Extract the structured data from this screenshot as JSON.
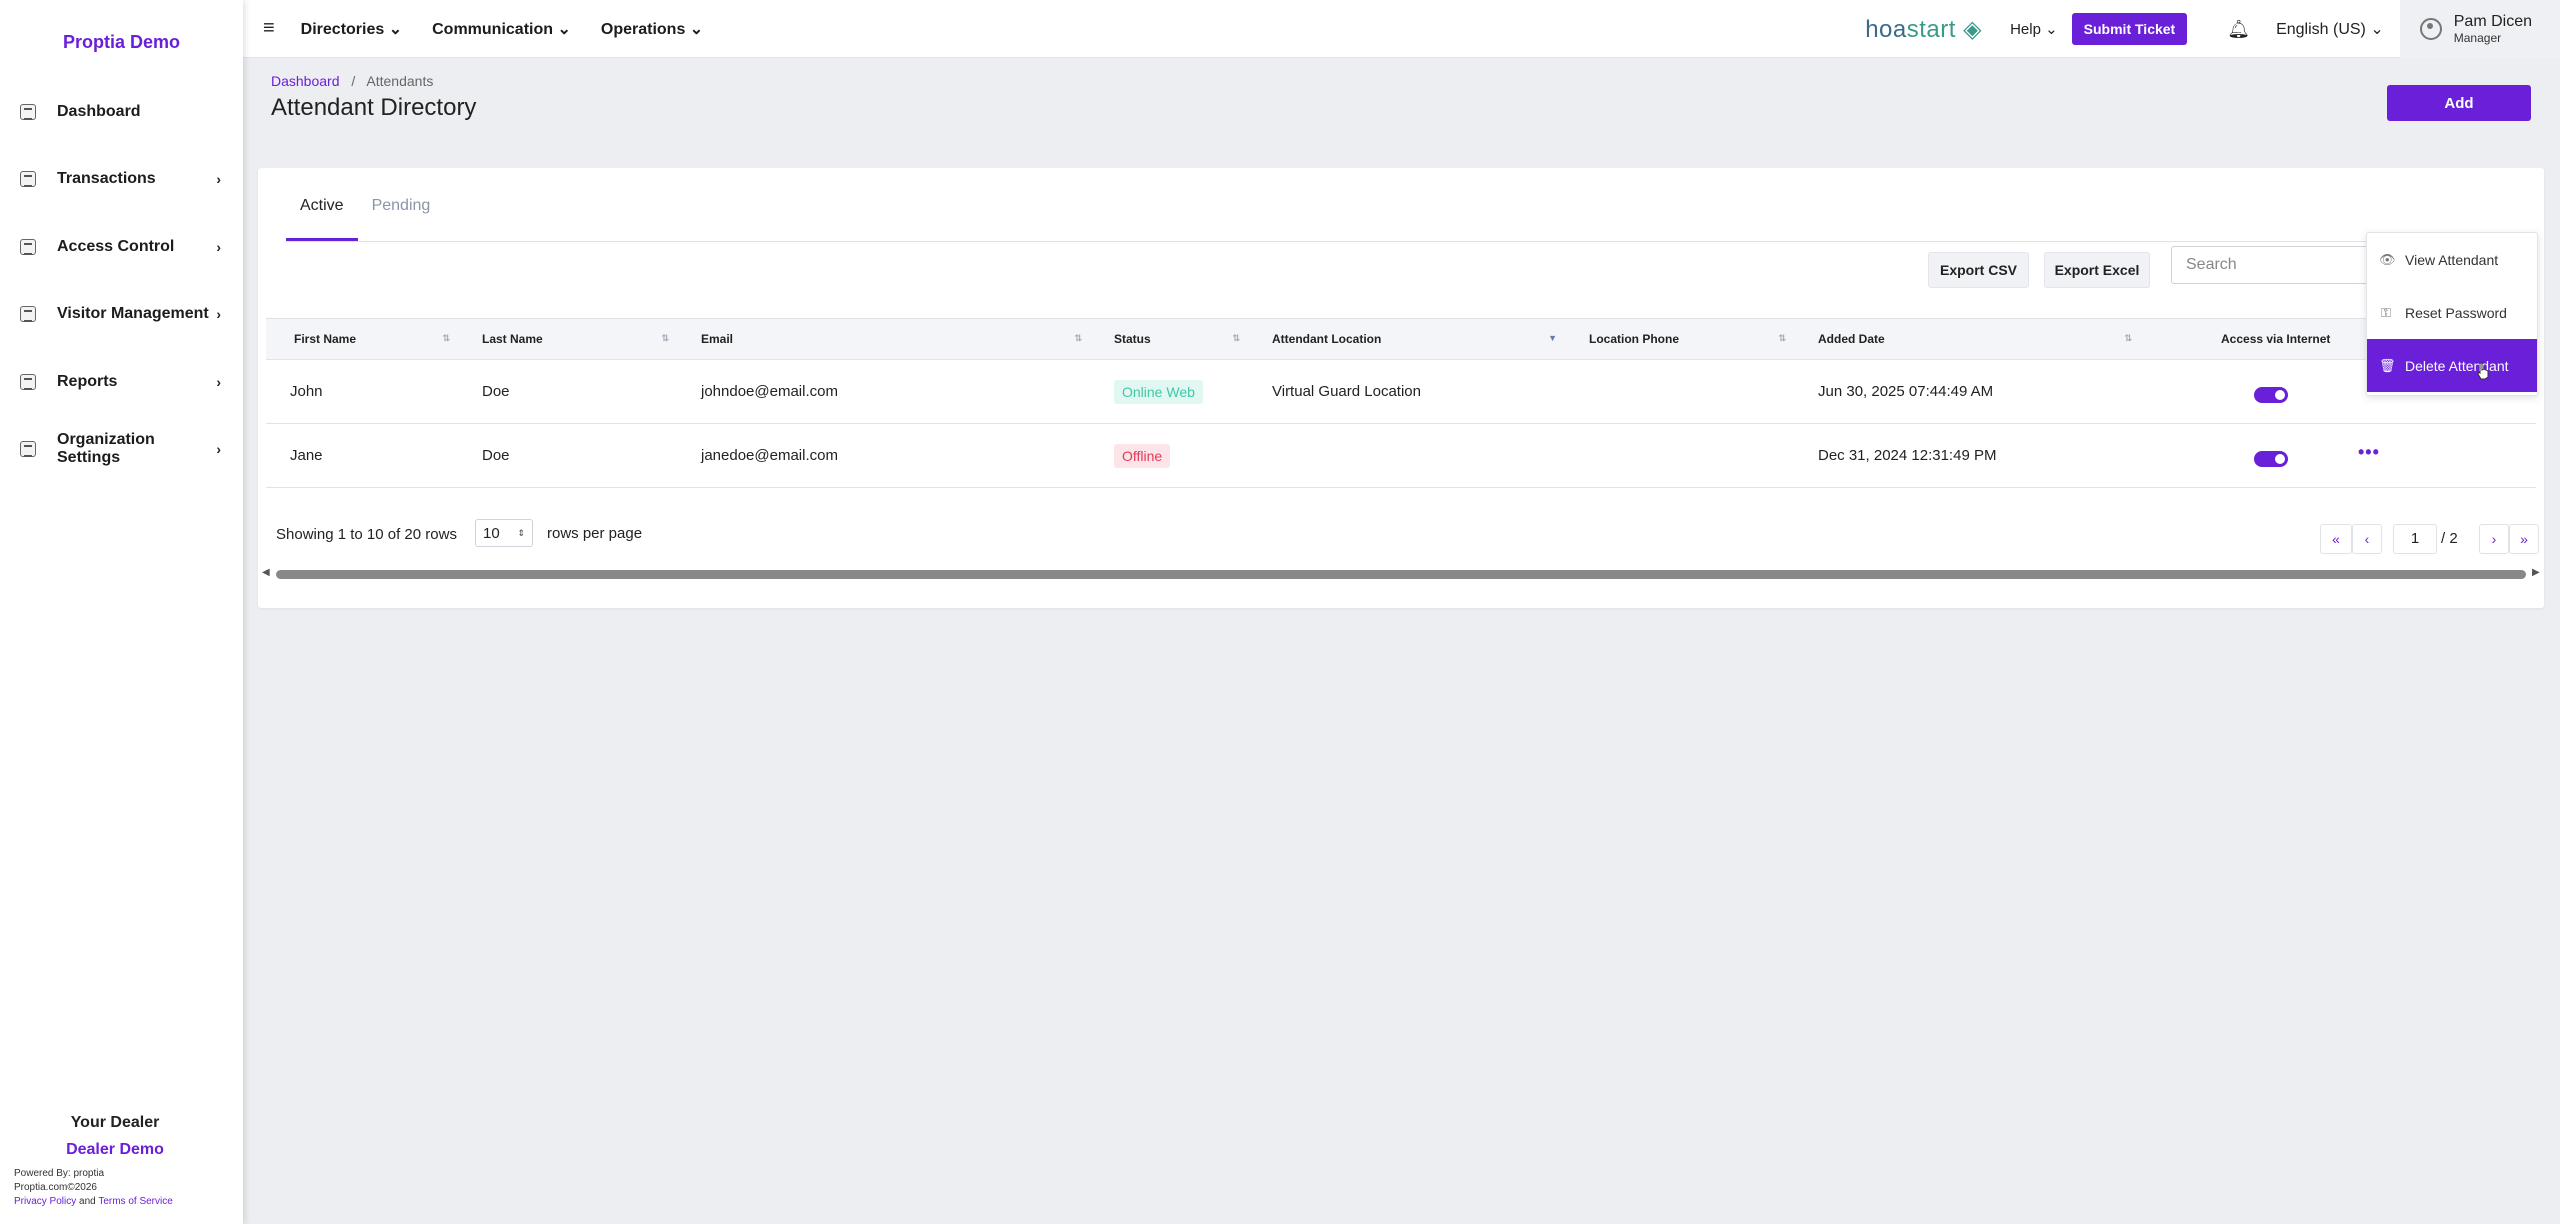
{
  "sidebar": {
    "brand": "Proptia Demo",
    "items": [
      {
        "label": "Dashboard",
        "icon": "dashboard-icon",
        "chevron": ""
      },
      {
        "label": "Transactions",
        "icon": "transactions-icon",
        "chevron": "›"
      },
      {
        "label": "Access Control",
        "icon": "access-control-icon",
        "chevron": "›"
      },
      {
        "label": "Visitor Management",
        "icon": "visitor-icon",
        "chevron": "›"
      },
      {
        "label": "Reports",
        "icon": "reports-icon",
        "chevron": "›"
      },
      {
        "label": "Organization Settings",
        "icon": "organization-icon",
        "chevron": "›"
      }
    ],
    "dealer_title": "Your Dealer",
    "dealer_name": "Dealer Demo",
    "powered_by": "Powered By: proptia",
    "copyright": "Proptia.com©2026",
    "privacy": "Privacy Policy",
    "and": "and",
    "terms": "Terms of Service"
  },
  "topbar": {
    "menu_directories": "Directories",
    "menu_communication": "Communication",
    "menu_operations": "Operations",
    "logo_a": "hoa",
    "logo_b": "start",
    "help": "Help",
    "submit_ticket": "Submit Ticket",
    "language": "English (US)",
    "user_name": "Pam Dicen",
    "user_role": "Manager"
  },
  "header": {
    "breadcrumb_home": "Dashboard",
    "breadcrumb_sep": "/",
    "breadcrumb_current": "Attendants",
    "title": "Attendant Directory",
    "add_button": "Add"
  },
  "tabs": {
    "active": "Active",
    "pending": "Pending"
  },
  "toolbar": {
    "export_csv": "Export CSV",
    "export_excel": "Export Excel",
    "search_placeholder": "Search"
  },
  "table": {
    "headers": [
      "First Name",
      "Last Name",
      "Email",
      "Status",
      "Attendant Location",
      "Location Phone",
      "Added Date",
      "Access via Internet"
    ],
    "rows": [
      {
        "first": "John",
        "last": "Doe",
        "email": "johndoe@email.com",
        "status": "Online Web",
        "location": "Virtual Guard Location",
        "phone": "",
        "added": "Jun 30, 2025 07:44:49 AM",
        "access": true
      },
      {
        "first": "Jane",
        "last": "Doe",
        "email": "janedoe@email.com",
        "status": "Offline",
        "location": "",
        "phone": "",
        "added": "Dec 31, 2024 12:31:49 PM",
        "access": true
      }
    ]
  },
  "pagination": {
    "showing": "Showing 1 to 10 of 20 rows",
    "rows_per_page_value": "10",
    "rows_per_page_label": "rows per page",
    "first": "«",
    "prev": "‹",
    "current_page": "1",
    "of_pages": "/ 2",
    "next": "›",
    "last": "»"
  },
  "dropdown": {
    "view": "View Attendant",
    "reset": "Reset Password",
    "delete": "Delete Attendant"
  },
  "colors": {
    "accent": "#6a1fd8",
    "online": "#42c7a6",
    "offline": "#e43a56"
  }
}
